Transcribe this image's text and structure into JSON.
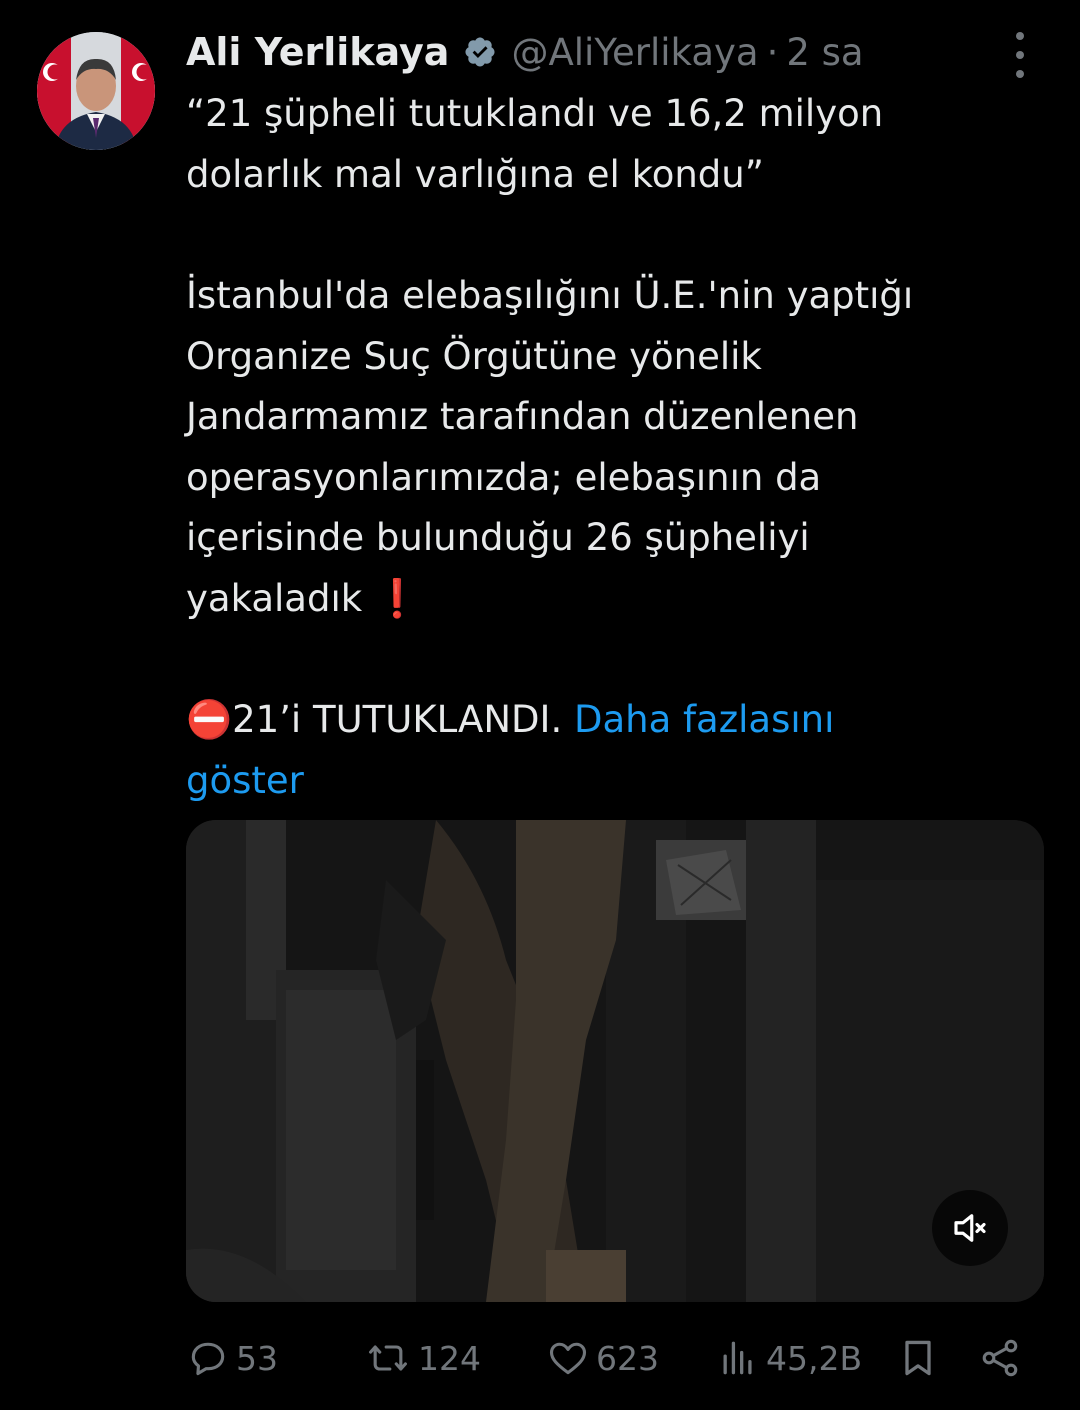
{
  "author": {
    "name": "Ali Yerlikaya",
    "handle": "@AliYerlikaya",
    "separator": "·",
    "time": "2 sa",
    "verified_color": "#829aab"
  },
  "tweet": {
    "lines": [
      "“21 şüpheli tutuklandı ve 16,2 milyon",
      "dolarlık mal varlığına el kondu”",
      "İstanbul'da elebaşılığını Ü.E.'nin yaptığı",
      "Organize Suç Örgütüne yönelik",
      "Jandarmamız tarafından düzenlenen",
      "operasyonlarımızda; elebaşının da",
      "içerisinde bulunduğu 26 şüpheliyi",
      "yakaladık"
    ],
    "exclamation_emoji": "❗",
    "arrest_emoji": "⛔",
    "arrest_text": "21’i TUTUKLANDI.",
    "show_more_line1": "Daha fazlasını",
    "show_more_line2": "göster",
    "link_color": "#1d9bf0"
  },
  "media": {
    "type": "video",
    "muted": true
  },
  "actions": {
    "replies": "53",
    "reposts": "124",
    "likes": "623",
    "views": "45,2B"
  },
  "icons": {
    "reply": "reply-icon",
    "repost": "repost-icon",
    "like": "heart-icon",
    "views": "views-icon",
    "bookmark": "bookmark-icon",
    "share": "share-icon",
    "more": "more-options-icon",
    "mute": "muted-speaker-icon"
  }
}
